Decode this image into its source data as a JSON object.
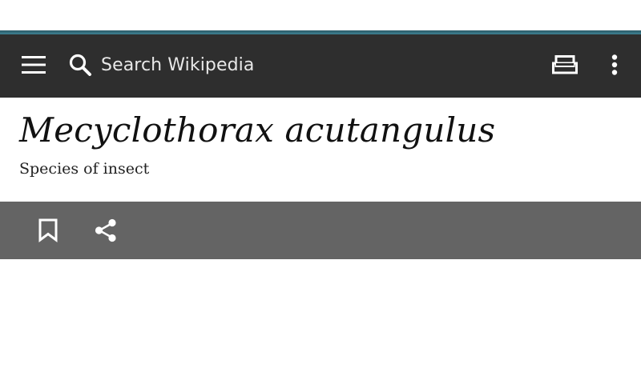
{
  "toolbar": {
    "search_placeholder": "Search Wikipedia",
    "menu_icon": "hamburger-menu-icon",
    "search_icon": "search-icon",
    "reader_icon": "reading-list-icon",
    "overflow_icon": "more-vert-icon"
  },
  "article": {
    "title": "Mecyclothorax acutangulus",
    "description": "Species of insect"
  },
  "actions": {
    "bookmark_icon": "bookmark-icon",
    "share_icon": "share-icon"
  },
  "colors": {
    "toolbar_bg": "#2e2e2e",
    "accent": "#3f8294",
    "action_bar_bg": "#646464",
    "icon_color": "#ffffff"
  }
}
